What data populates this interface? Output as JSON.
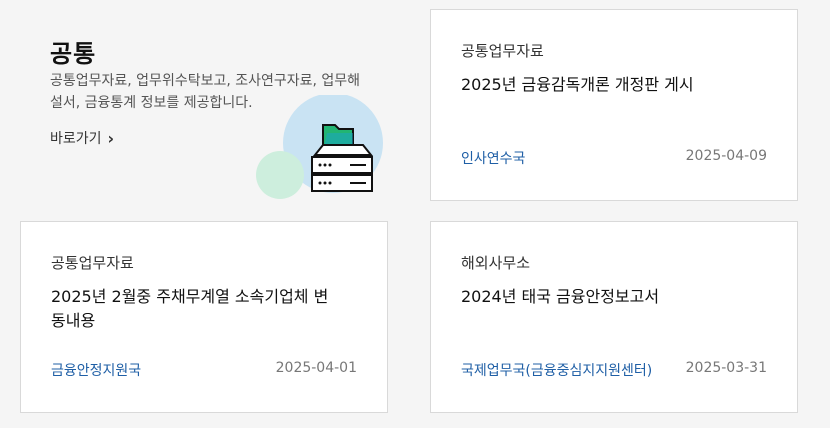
{
  "intro": {
    "title": "공통",
    "description": "공통업무자료, 업무위수탁보고, 조사연구자료, 업무해설서, 금융통계 정보를 제공합니다.",
    "link_label": "바로가기"
  },
  "cards": [
    {
      "category": "공통업무자료",
      "title": "2025년 금융감독개론 개정판 게시",
      "department": "인사연수국",
      "date": "2025-04-09"
    },
    {
      "category": "공통업무자료",
      "title": "2025년 2월중 주채무계열 소속기업체 변동내용",
      "department": "금융안정지원국",
      "date": "2025-04-01"
    },
    {
      "category": "해외사무소",
      "title": "2024년 태국 금융안정보고서",
      "department": "국제업무국(금융중심지지원센터)",
      "date": "2025-03-31"
    }
  ],
  "colors": {
    "accent": "#1f5fa6",
    "circle_blue": "#c9e3f3",
    "circle_green": "#cdeedd",
    "folder_green": "#22b573"
  },
  "icons": {
    "link_arrow": "chevron-right-icon",
    "illustration": "server-folder-illustration"
  }
}
